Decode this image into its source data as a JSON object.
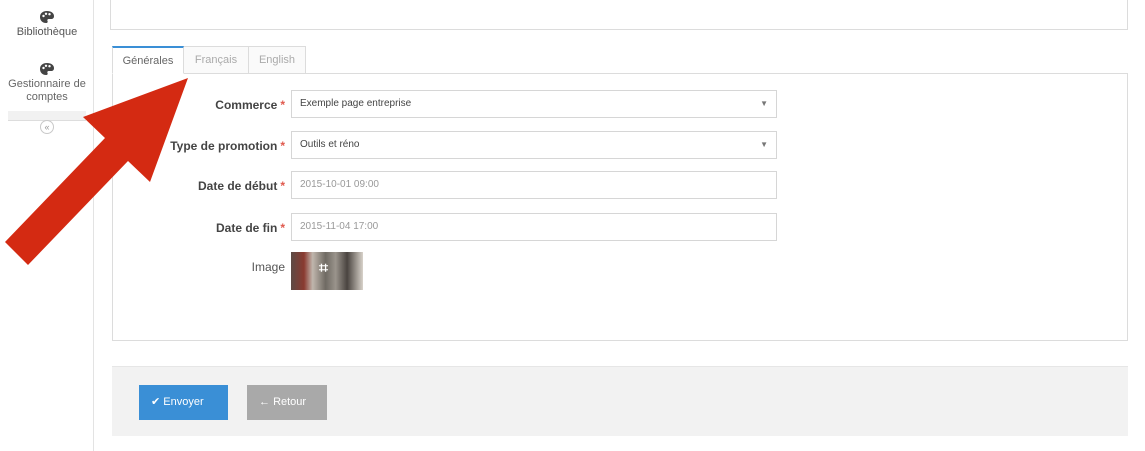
{
  "sidebar": {
    "items": [
      {
        "label": "Bibliothèque",
        "icon": "palette-icon"
      },
      {
        "label": "Gestionnaire de comptes",
        "icon": "palette-icon"
      }
    ],
    "collapse_glyph": "«"
  },
  "tabs": [
    {
      "label": "Générales",
      "active": true
    },
    {
      "label": "Français",
      "active": false
    },
    {
      "label": "English",
      "active": false
    }
  ],
  "form": {
    "commerce": {
      "label": "Commerce",
      "value": "Exemple page entreprise"
    },
    "promo_type": {
      "label": "Type de promotion",
      "value": "Outils et réno"
    },
    "start_date": {
      "label": "Date de début",
      "value": "2015-10-01 09:00"
    },
    "end_date": {
      "label": "Date de fin",
      "value": "2015-11-04 17:00"
    },
    "image": {
      "label": "Image"
    },
    "required_mark": "*"
  },
  "actions": {
    "send_label": "Envoyer",
    "back_label": "Retour"
  },
  "colors": {
    "accent": "#3a8fd6",
    "required": "#e05a4e",
    "annotation_arrow": "#d42a12"
  }
}
